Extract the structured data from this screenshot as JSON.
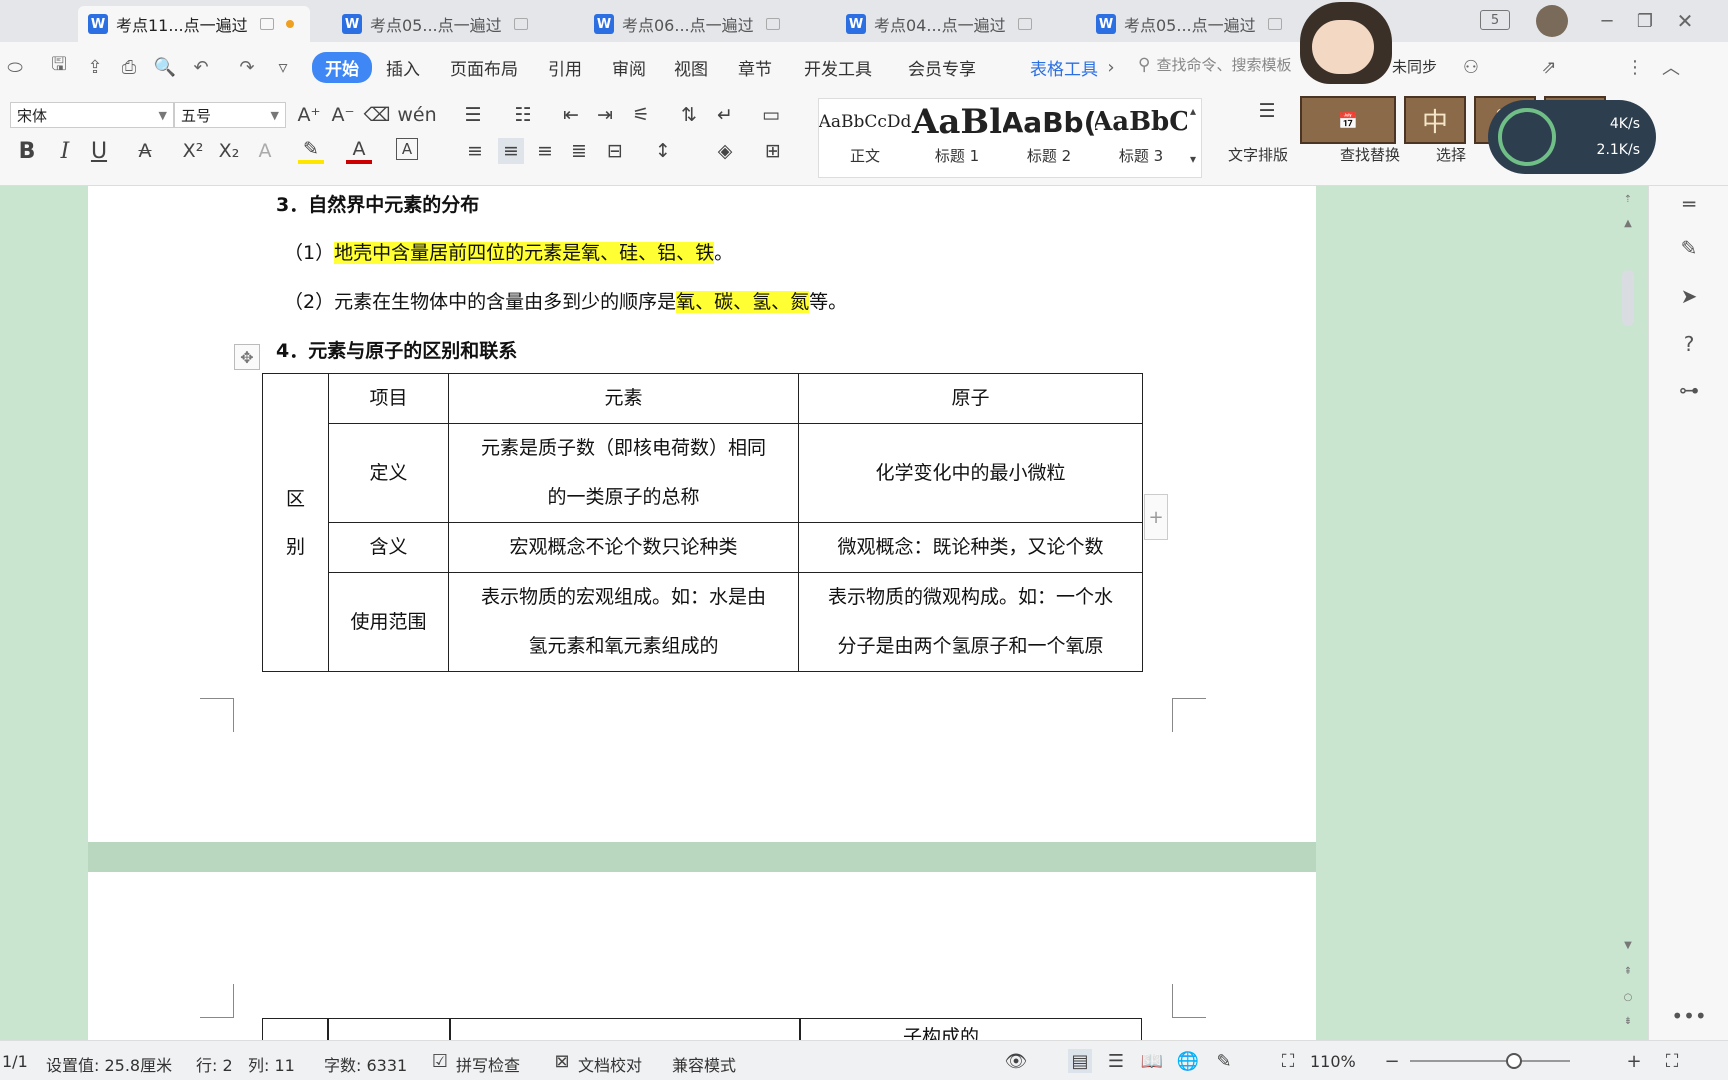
{
  "tabs": [
    {
      "label": "考点11...点一遍过",
      "active": true,
      "modified": true
    },
    {
      "label": "考点05...点一遍过",
      "active": false
    },
    {
      "label": "考点06...点一遍过",
      "active": false
    },
    {
      "label": "考点04...点一遍过",
      "active": false
    },
    {
      "label": "考点05...点一遍过",
      "active": false
    }
  ],
  "window": {
    "tab_count_badge": "5"
  },
  "menu": {
    "items": [
      "开始",
      "插入",
      "页面布局",
      "引用",
      "审阅",
      "视图",
      "章节",
      "开发工具",
      "会员专享"
    ],
    "active": "开始",
    "context_tab": "表格工具",
    "search_placeholder": "查找命令、搜索模板",
    "sync_label": "未同步"
  },
  "ribbon": {
    "font_name": "宋体",
    "font_size": "五号",
    "styles": [
      {
        "sample": "AaBbCcDd",
        "name": "正文"
      },
      {
        "sample": "AaBl",
        "name": "标题 1"
      },
      {
        "sample": "AaBb(",
        "name": "标题 2"
      },
      {
        "sample": "AaBbC",
        "name": "标题 3"
      }
    ],
    "text_layout_label": "文字排版",
    "find_replace_label": "查找替换",
    "select_label": "选择"
  },
  "network": {
    "up": "4K/s",
    "down": "2.1K/s"
  },
  "document": {
    "section3_heading": "3．自然界中元素的分布",
    "line1_prefix": "（1）",
    "line1_highlight": "地壳中含量居前四位的元素是氧、硅、铝、铁",
    "line1_suffix": "。",
    "line2_prefix": "（2）元素在生物体中的含量由多到少的顺序是",
    "line2_highlight": "氧、碳、氢、氮",
    "line2_suffix": "等。",
    "section4_heading": "4．元素与原子的区别和联系",
    "table": {
      "group_label_1": "区",
      "group_label_2": "别",
      "headers": [
        "项目",
        "元素",
        "原子"
      ],
      "rows": [
        {
          "item": "定义",
          "element": [
            "元素是质子数（即核电荷数）相同",
            "的一类原子的总称"
          ],
          "atom": [
            "化学变化中的最小微粒"
          ]
        },
        {
          "item": "含义",
          "element": [
            "宏观概念不论个数只论种类"
          ],
          "atom": [
            "微观概念：既论种类，又论个数"
          ]
        },
        {
          "item": "使用范围",
          "element": [
            "表示物质的宏观组成。如：水是由",
            "氢元素和氧元素组成的"
          ],
          "atom": [
            "表示物质的微观构成。如：一个水",
            "分子是由两个氢原子和一个氧原"
          ]
        }
      ]
    },
    "page2_partial_text": "子构成的"
  },
  "status": {
    "page": "1/1",
    "setting_value": "设置值: 25.8厘米",
    "row": "行: 2",
    "col": "列: 11",
    "word_count": "字数: 6331",
    "spell_check": "拼写检查",
    "doc_proof": "文档校对",
    "compat_mode": "兼容模式",
    "zoom": "110%"
  },
  "colors": {
    "accent": "#3f87f5",
    "highlight": "#ffff33",
    "doc_bg": "#c9e5cf",
    "word_blue": "#2b6fe3"
  }
}
